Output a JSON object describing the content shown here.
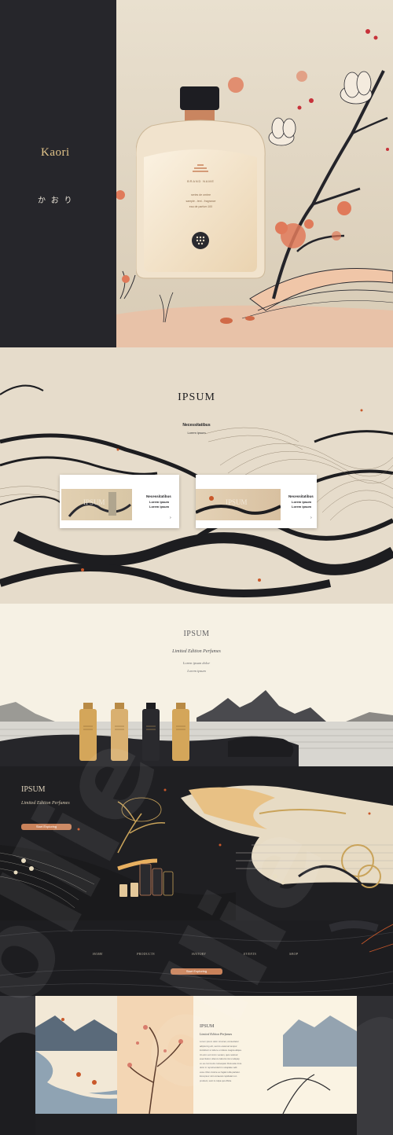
{
  "hero": {
    "brand": "Kaori",
    "brand_jp": "か お り",
    "bottle_label_top": "BRAND NAME",
    "bottle_label_lines": [
      "series de ombre",
      "sample - text - fragrance",
      "eau de parfum  100"
    ]
  },
  "section2": {
    "heading": "IPSUM",
    "subheading": "Necessitatibus",
    "subtext": "Lorem ipsum",
    "cards": [
      {
        "image_text": "IPSUM",
        "title": "Necessitatibus",
        "line1": "Lorem ipsum",
        "line2": "Lorem ipsum",
        "arrow": "›"
      },
      {
        "image_text": "IPSUM",
        "title": "Necessitatibus",
        "line1": "Lorem ipsum",
        "line2": "Lorem ipsum",
        "arrow": "›"
      }
    ]
  },
  "section3": {
    "heading": "IPSUM",
    "subheading": "Limited Edition Perfumes",
    "line1": "Lorem ipsum dolor",
    "line2": "Lorem ipsum"
  },
  "section4": {
    "heading": "IPSUM",
    "subheading": "Limited Edition Perfumes",
    "button": "Start Exploring"
  },
  "section5": {
    "nav": [
      "HOME",
      "PRODUCTS",
      "HISTORY",
      "EVENTS",
      "SHOP"
    ],
    "button": "Start Exploring"
  },
  "section6": {
    "heading": "IPSUM",
    "subheading": "Limited Edition Perfumes",
    "lines": [
      "Lorem ipsum dolor sit amet, consectetur",
      "adipiscing elit, sed do eiusmod tempor",
      "incididunt ut labore et dolore magna aliqua.",
      "Ut enim ad minim veniam, quis nostrud",
      "exercitation ullamco laboris nisi ut aliquip",
      "ex ea commodo consequat. Duis aute irure",
      "dolor in reprehenderit in voluptate velit",
      "esse cillum dolore eu fugiat nulla pariatur.",
      "Excepteur sint occaecat cupidatat non",
      "proident, sunt in culpa qui officia."
    ]
  },
  "watermark": "ollie",
  "colors": {
    "dark_panel": "#2a2a30",
    "beige": "#e6dccb",
    "accent": "#c9825a",
    "gold": "#c9a35a",
    "ink": "#1d1d20"
  }
}
